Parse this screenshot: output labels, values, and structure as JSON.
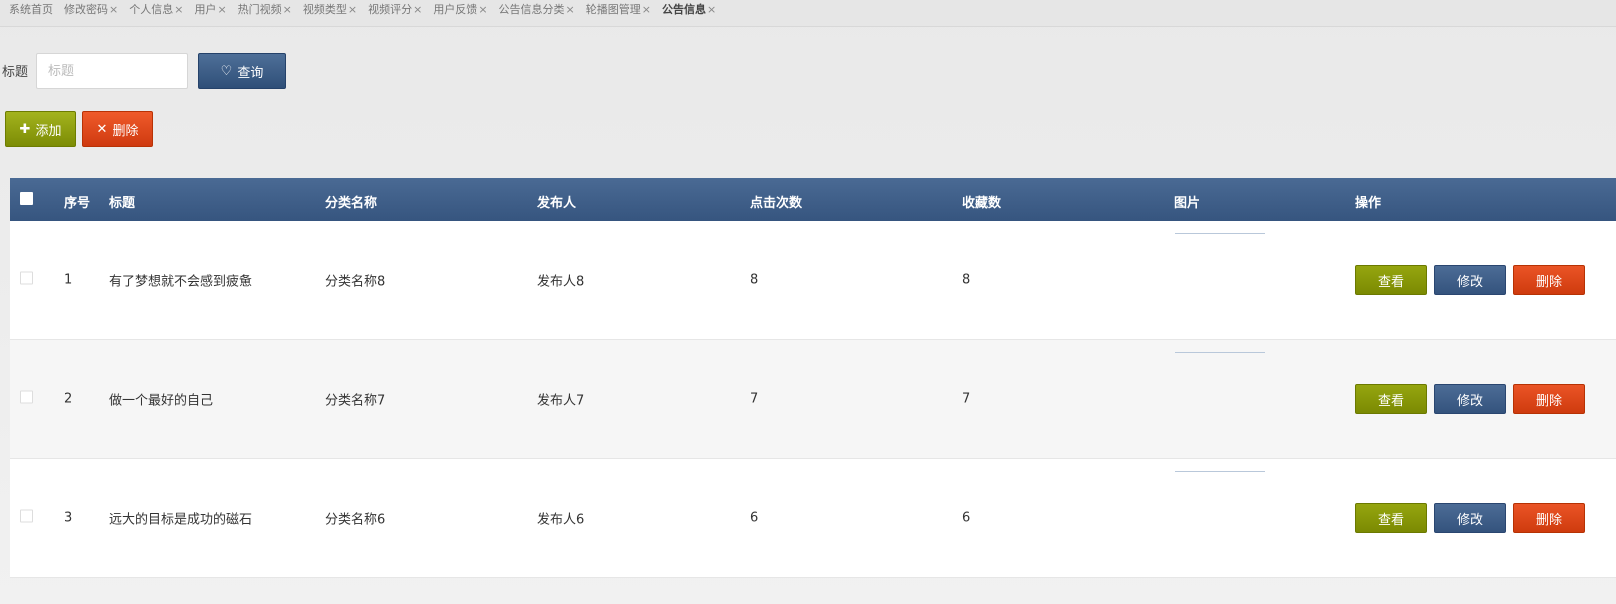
{
  "tabs": [
    {
      "label": "系统首页",
      "closable": false
    },
    {
      "label": "修改密码",
      "closable": true
    },
    {
      "label": "个人信息",
      "closable": true
    },
    {
      "label": "用户",
      "closable": true
    },
    {
      "label": "热门视频",
      "closable": true
    },
    {
      "label": "视频类型",
      "closable": true
    },
    {
      "label": "视频评分",
      "closable": true
    },
    {
      "label": "用户反馈",
      "closable": true
    },
    {
      "label": "公告信息分类",
      "closable": true
    },
    {
      "label": "轮播图管理",
      "closable": true
    },
    {
      "label": "公告信息",
      "closable": true,
      "active": true
    }
  ],
  "tab_close_glyph": "×",
  "search": {
    "label": "标题",
    "placeholder": "标题",
    "value": "",
    "query_label": "查询",
    "query_icon": "heart-icon"
  },
  "toolbar": {
    "add_label": "添加",
    "add_icon": "plus-icon",
    "delete_label": "删除",
    "delete_icon": "x-icon"
  },
  "table": {
    "headers": {
      "no": "序号",
      "title": "标题",
      "category": "分类名称",
      "publisher": "发布人",
      "clicks": "点击次数",
      "favorites": "收藏数",
      "image": "图片",
      "actions": "操作"
    },
    "rows": [
      {
        "no": "1",
        "title": "有了梦想就不会感到疲惫",
        "category": "分类名称8",
        "publisher": "发布人8",
        "clicks": "8",
        "favorites": "8"
      },
      {
        "no": "2",
        "title": "做一个最好的自己",
        "category": "分类名称7",
        "publisher": "发布人7",
        "clicks": "7",
        "favorites": "7"
      },
      {
        "no": "3",
        "title": "远大的目标是成功的磁石",
        "category": "分类名称6",
        "publisher": "发布人6",
        "clicks": "6",
        "favorites": "6"
      }
    ],
    "row_actions": {
      "view": "查看",
      "edit": "修改",
      "delete": "删除"
    }
  },
  "colors": {
    "header_bg": "#3e5e88",
    "view_btn": "#869606",
    "edit_btn": "#3f5f88",
    "delete_btn": "#dd4518"
  }
}
